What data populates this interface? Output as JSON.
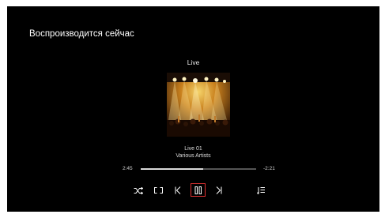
{
  "now_playing": {
    "heading": "Воспроизводится сейчас",
    "album": "Live"
  },
  "track": {
    "title": "Live 01",
    "artist": "Various Artists"
  },
  "progress": {
    "elapsed": "2:45",
    "remaining": "-2:21",
    "fraction": 0.54
  },
  "controls": [
    {
      "name": "shuffle",
      "icon": "shuffle-icon"
    },
    {
      "name": "repeat",
      "icon": "repeat-icon"
    },
    {
      "name": "previous",
      "icon": "skip-previous-icon"
    },
    {
      "name": "play-pause",
      "icon": "pause-icon"
    },
    {
      "name": "next",
      "icon": "skip-next-icon"
    },
    {
      "name": "queue",
      "icon": "queue-icon"
    }
  ],
  "colors": {
    "background": "#000000",
    "accent": "#e03131",
    "text": "#ffffff"
  }
}
